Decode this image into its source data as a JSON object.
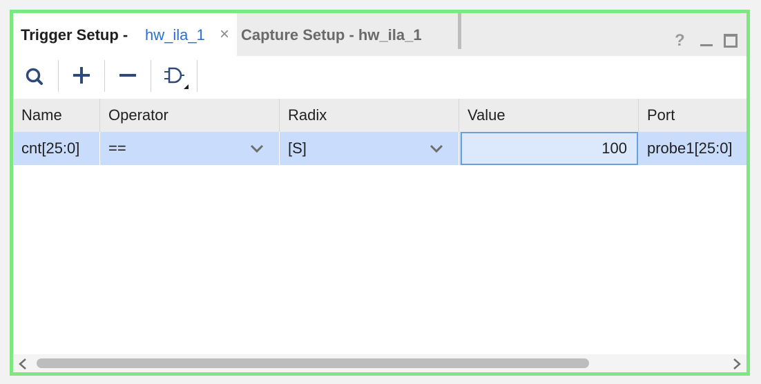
{
  "tabs": {
    "active": {
      "title_bold": "Trigger Setup - ",
      "title_link": "hw_ila_1",
      "close": "×"
    },
    "inactive": {
      "title": "Capture Setup - hw_ila_1"
    }
  },
  "window_controls": {
    "help": "?",
    "minimize": "minimize-icon",
    "maximize": "maximize-icon"
  },
  "toolbar": {
    "buttons": [
      {
        "icon": "search-icon"
      },
      {
        "icon": "plus-icon"
      },
      {
        "icon": "minus-icon"
      },
      {
        "icon": "and-gate-icon"
      }
    ]
  },
  "table": {
    "columns": [
      "Name",
      "Operator",
      "Radix",
      "Value",
      "Port"
    ],
    "rows": [
      {
        "name": "cnt[25:0]",
        "operator": "==",
        "radix": "[S]",
        "value": "100",
        "port": "probe1[25:0]"
      }
    ]
  },
  "colors": {
    "frame_border": "#7fe77f",
    "selected_row": "#c9dcfb",
    "link_blue": "#2b6fd6",
    "icon_blue": "#2d4a78"
  }
}
